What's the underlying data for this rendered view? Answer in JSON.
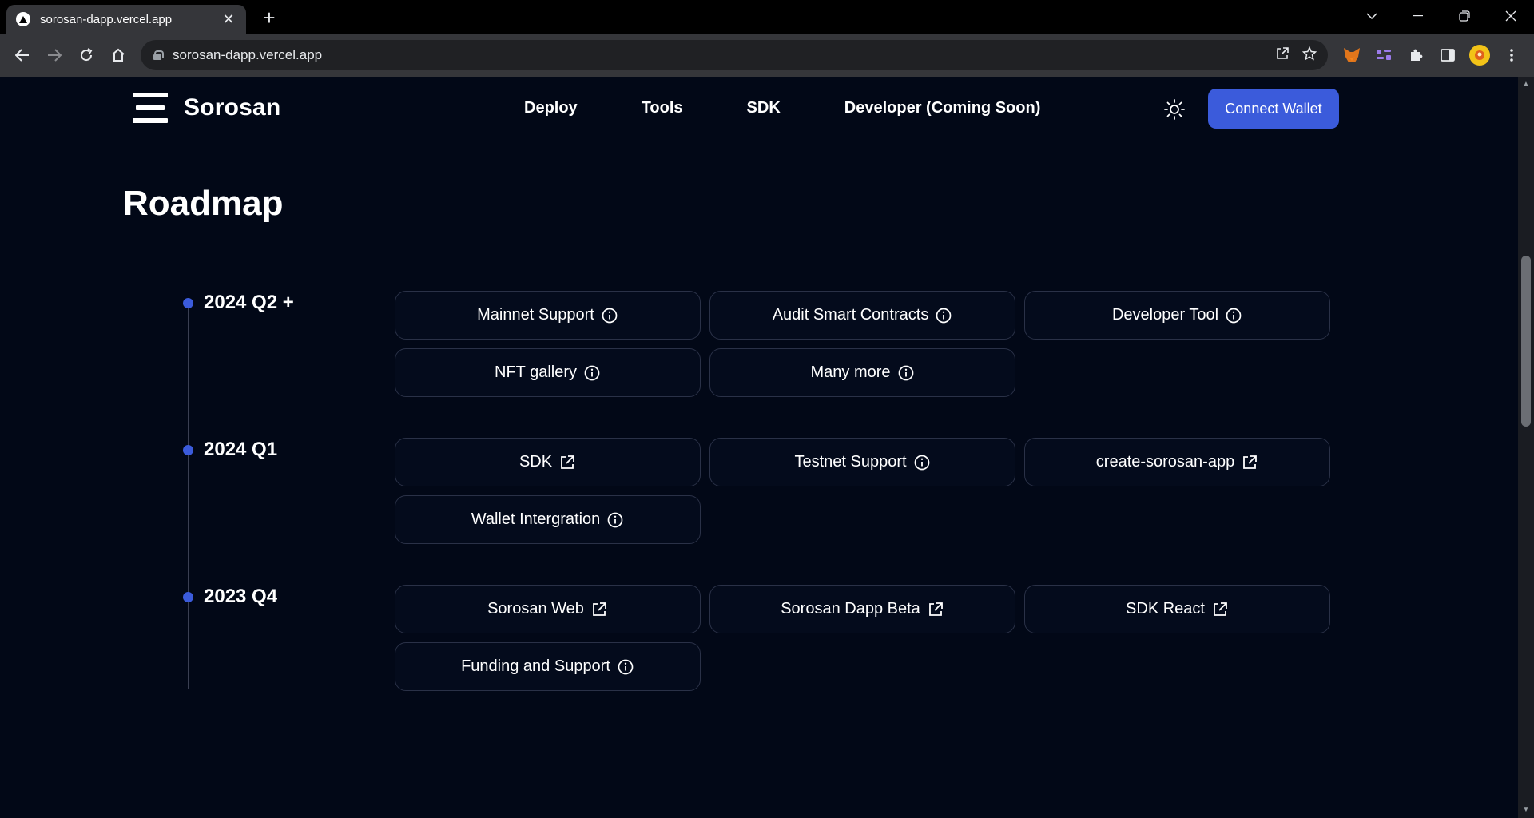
{
  "browser": {
    "tab_title": "sorosan-dapp.vercel.app",
    "url": "sorosan-dapp.vercel.app"
  },
  "site": {
    "logo_text": "Sorosan",
    "nav": [
      "Deploy",
      "Tools",
      "SDK",
      "Developer (Coming Soon)"
    ],
    "connect_label": "Connect Wallet"
  },
  "roadmap": {
    "title": "Roadmap",
    "quarters": [
      {
        "label": "2024 Q2 +",
        "items": [
          {
            "label": "Mainnet Support",
            "icon": "info-icon"
          },
          {
            "label": "Audit Smart Contracts",
            "icon": "info-icon"
          },
          {
            "label": "Developer Tool",
            "icon": "info-icon"
          },
          {
            "label": "NFT gallery",
            "icon": "info-icon"
          },
          {
            "label": "Many more",
            "icon": "info-icon"
          }
        ]
      },
      {
        "label": "2024 Q1",
        "items": [
          {
            "label": "SDK",
            "icon": "external-link-icon"
          },
          {
            "label": "Testnet Support",
            "icon": "info-icon"
          },
          {
            "label": "create-sorosan-app",
            "icon": "external-link-icon"
          },
          {
            "label": "Wallet Intergration",
            "icon": "info-icon"
          }
        ]
      },
      {
        "label": "2023 Q4",
        "items": [
          {
            "label": "Sorosan Web",
            "icon": "external-link-icon"
          },
          {
            "label": "Sorosan Dapp Beta",
            "icon": "external-link-icon"
          },
          {
            "label": "SDK React",
            "icon": "external-link-icon"
          },
          {
            "label": "Funding and Support",
            "icon": "info-icon"
          }
        ]
      }
    ]
  },
  "colors": {
    "background": "#020817",
    "accent": "#3b5bdb",
    "card_border": "#2a3147"
  }
}
